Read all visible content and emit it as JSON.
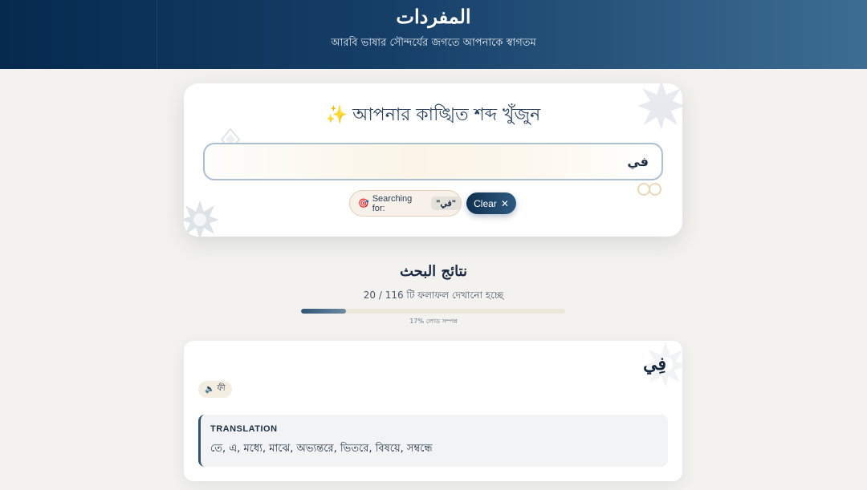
{
  "header": {
    "title": "المفردات",
    "subtitle": "আরবি ভাষার সৌন্দর্যের জগতে আপনাকে স্বাগতম"
  },
  "search": {
    "heading": "আপনার কাঙ্খিত শব্দ খুঁজুন",
    "heading_icon": "sparkles-icon",
    "value": "في",
    "searching_label": "Searching for:",
    "searching_term": "\"في\"",
    "searching_icon": "target-icon",
    "clear_label": "Clear",
    "clear_icon": "close-icon"
  },
  "results": {
    "title": "نتائج البحث",
    "count_text": "20 / 116 টি ফলাফল দেখানো হচ্ছে",
    "progress_percent": 17,
    "progress_text": "17% লোড সম্পন্ন"
  },
  "entries": [
    {
      "word": "فِي",
      "pronunciation": "ফী",
      "pronunciation_icon": "speaker-icon",
      "translation_label": "TRANSLATION",
      "translation": "তে, এ, মধ্যে, মাঝে, অভ্যন্তরে, ভিতরে, বিষয়ে, সম্বন্ধে"
    }
  ],
  "colors": {
    "header_start": "#062a4e",
    "header_end": "#3d6d93",
    "accent": "#1e2f45",
    "background": "#f3f2ee"
  }
}
